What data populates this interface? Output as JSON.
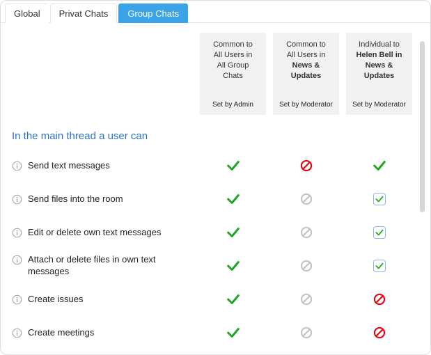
{
  "tabs": {
    "global": "Global",
    "private": "Privat Chats",
    "group": "Group Chats"
  },
  "columns": [
    {
      "lines": [
        "Common to",
        "All Users in",
        "All Group",
        "Chats"
      ],
      "bold": [
        false,
        false,
        false,
        false
      ],
      "setby": "Set by Admin"
    },
    {
      "lines": [
        "Common to",
        "All Users in",
        "News &",
        "Updates"
      ],
      "bold": [
        false,
        false,
        true,
        true
      ],
      "setby": "Set by Moderator"
    },
    {
      "lines": [
        "Individual to",
        "Helen Bell in",
        "News &",
        "Updates"
      ],
      "bold": [
        false,
        true,
        true,
        true
      ],
      "setby": "Set by Moderator"
    }
  ],
  "section_title": "In the main thread a user can",
  "rows": [
    {
      "label": "Send text messages",
      "cells": [
        "check",
        "ban-red",
        "check"
      ]
    },
    {
      "label": "Send files into the room",
      "cells": [
        "check",
        "ban-gray",
        "cb-checked"
      ]
    },
    {
      "label": "Edit or delete own text messages",
      "cells": [
        "check",
        "ban-gray",
        "cb-checked"
      ]
    },
    {
      "label": "Attach or delete files in own text messages",
      "cells": [
        "check",
        "ban-gray",
        "cb-checked"
      ]
    },
    {
      "label": "Create issues",
      "cells": [
        "check",
        "ban-gray",
        "ban-red"
      ]
    },
    {
      "label": "Create meetings",
      "cells": [
        "check",
        "ban-gray",
        "ban-red"
      ]
    }
  ]
}
